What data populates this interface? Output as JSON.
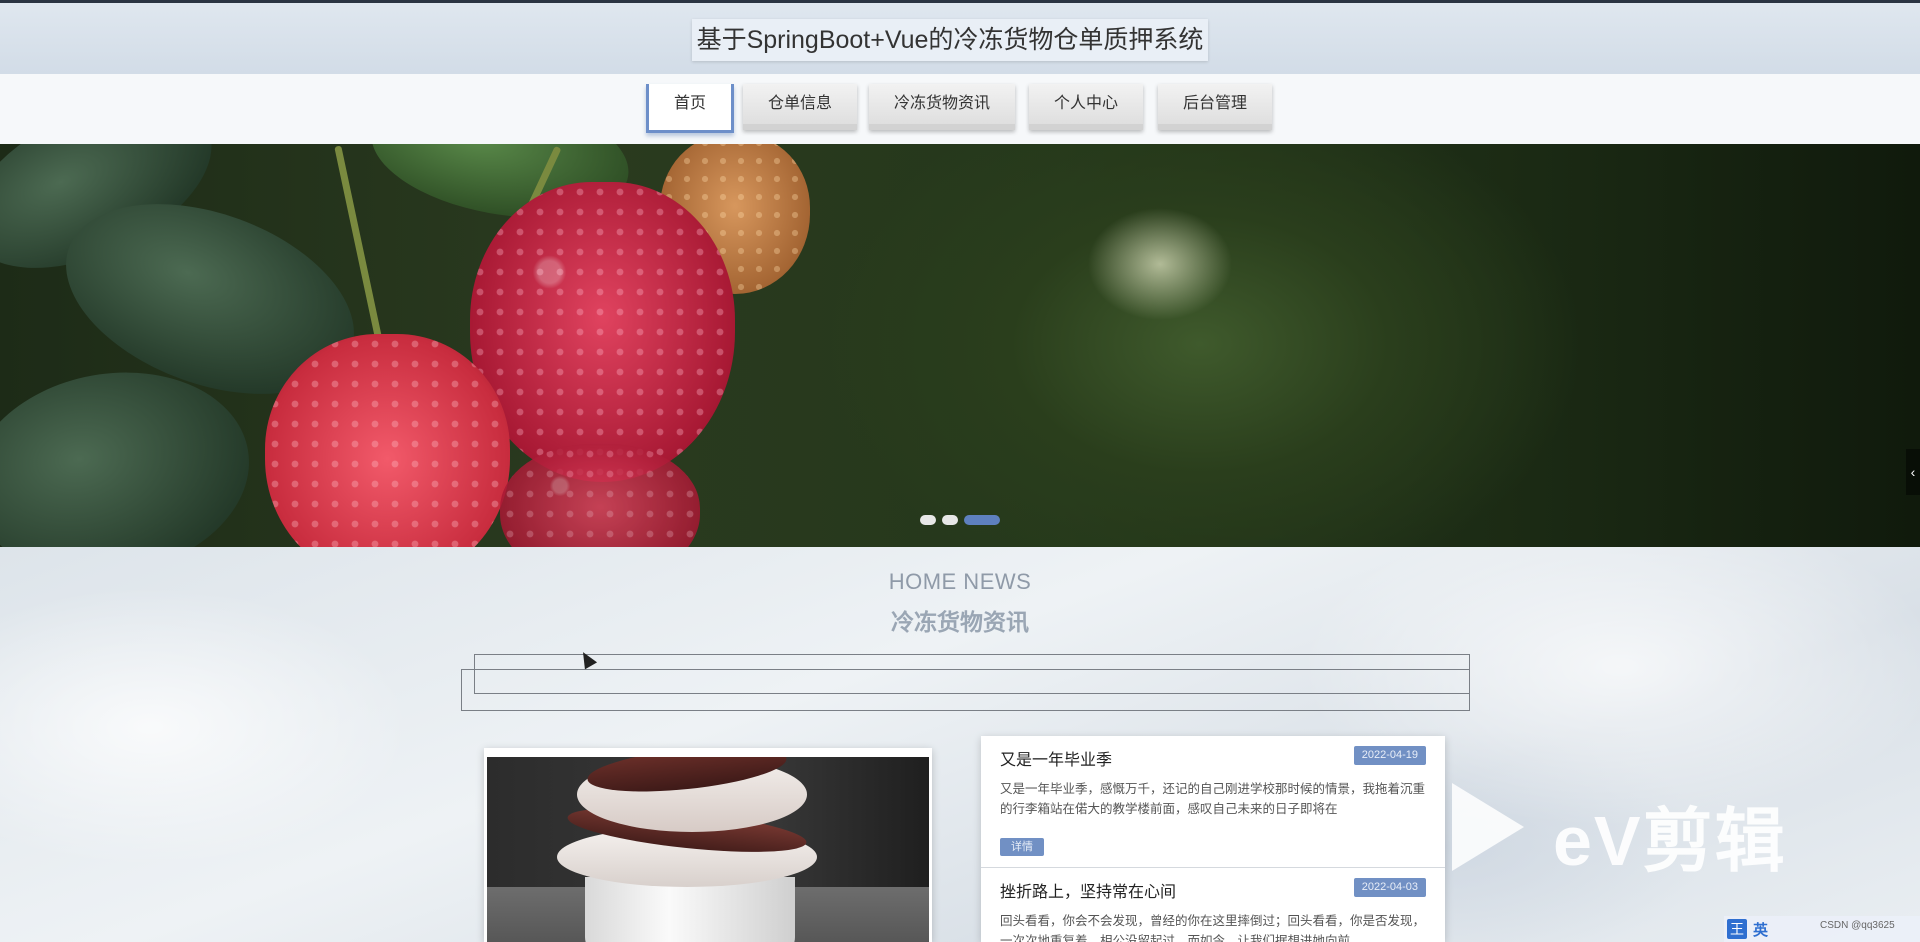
{
  "header": {
    "title": "基于SpringBoot+Vue的冷冻货物仓单质押系统"
  },
  "nav": {
    "items": [
      {
        "label": "首页",
        "active": true
      },
      {
        "label": "仓单信息",
        "active": false
      },
      {
        "label": "冷冻货物资讯",
        "active": false
      },
      {
        "label": "个人中心",
        "active": false
      },
      {
        "label": "后台管理",
        "active": false
      }
    ]
  },
  "carousel": {
    "slide_count": 3,
    "active_index": 2,
    "next_arrow": "‹"
  },
  "news_section": {
    "title_en": "HOME NEWS",
    "title_cn": "冷冻货物资讯",
    "items": [
      {
        "title": "又是一年毕业季",
        "date": "2022-04-19",
        "excerpt": "又是一年毕业季，感慨万千，还记的自己刚进学校那时候的情景，我拖着沉重的行李箱站在偌大的教学楼前面，感叹自己未来的日子即将在",
        "detail_label": "详情"
      },
      {
        "title": "挫折路上，坚持常在心间",
        "date": "2022-04-03",
        "excerpt": "回头看看，你会不会发现，曾经的你在这里摔倒过；回头看看，你是否发现，一次次地重复着，相公没留起过，而如今，让我们据想进她向前"
      }
    ]
  },
  "watermark": {
    "text": "eV剪辑"
  },
  "system_tray": {
    "ime_label": "王",
    "lang_label": "英",
    "csdn_text": "CSDN @qq3625"
  },
  "colors": {
    "accent": "#7190c4",
    "nav_active_border": "#6d8fc9",
    "title_bar": "#dfe7ef"
  }
}
